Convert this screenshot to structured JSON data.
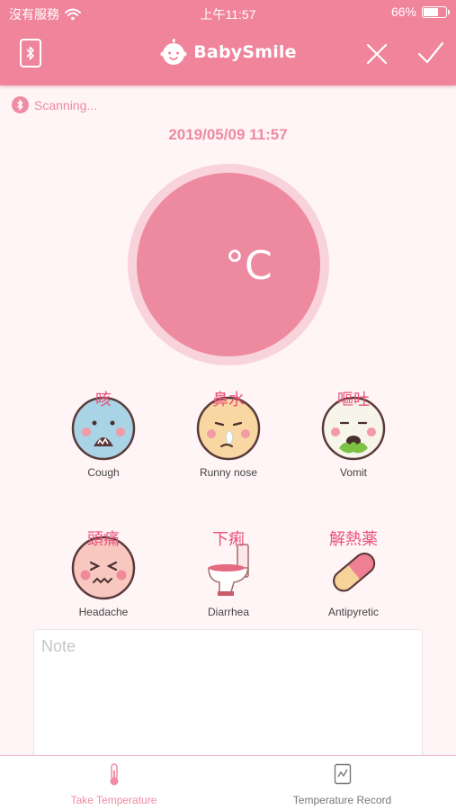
{
  "status": {
    "carrier": "沒有服務",
    "time": "上午11:57",
    "battery": "66%",
    "battery_level": 0.66
  },
  "header": {
    "brand": "BabySmile"
  },
  "scan": {
    "text": "Scanning..."
  },
  "reading": {
    "datetime": "2019/05/09 11:57",
    "unit": "°C"
  },
  "symptoms": [
    {
      "cn": "咳",
      "en": "Cough"
    },
    {
      "cn": "鼻水",
      "en": "Runny nose"
    },
    {
      "cn": "嘔吐",
      "en": "Vomit"
    },
    {
      "cn": "頭痛",
      "en": "Headache"
    },
    {
      "cn": "下痢",
      "en": "Diarrhea"
    },
    {
      "cn": "解熱薬",
      "en": "Antipyretic"
    }
  ],
  "note": {
    "placeholder": "Note",
    "value": ""
  },
  "tabs": [
    {
      "label": "Take Temperature",
      "active": true
    },
    {
      "label": "Temperature Record",
      "active": false
    }
  ],
  "colors": {
    "brand_pink": "#f0849b",
    "circle_pink": "#ee8aa0",
    "label_pink": "#e9517a"
  }
}
